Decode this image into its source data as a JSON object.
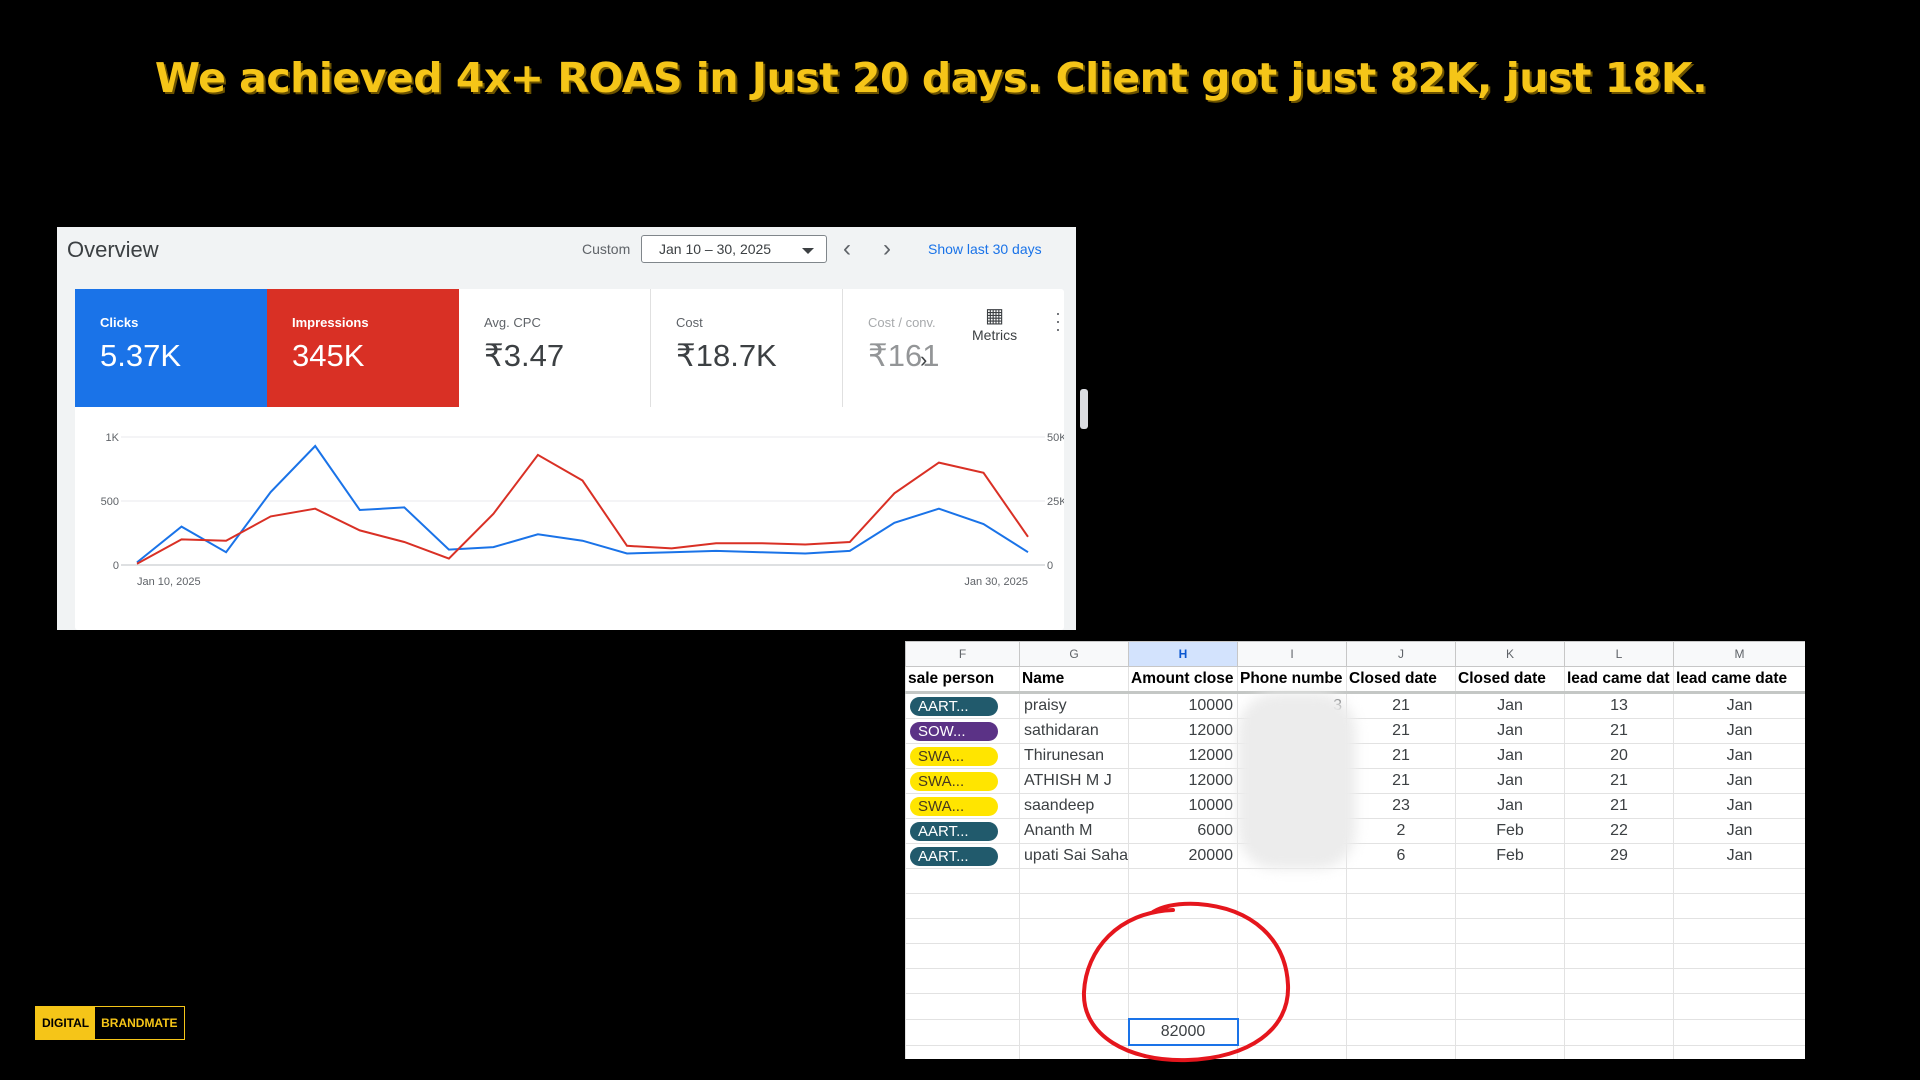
{
  "headline": "We achieved 4x+ ROAS in Just 20 days. Client got just 82K, just 18K.",
  "ads": {
    "title": "Overview",
    "custom_label": "Custom",
    "date_range": "Jan 10 – 30, 2025",
    "show_last": "Show last 30 days",
    "metrics_label": "Metrics",
    "tiles": [
      {
        "label": "Clicks",
        "value": "5.37K"
      },
      {
        "label": "Impressions",
        "value": "345K"
      },
      {
        "label": "Avg. CPC",
        "value": "₹3.47"
      },
      {
        "label": "Cost",
        "value": "₹18.7K"
      },
      {
        "label": "Cost / conv.",
        "value": "₹161"
      }
    ]
  },
  "chart_data": {
    "type": "line",
    "x_start_label": "Jan 10, 2025",
    "x_end_label": "Jan 30, 2025",
    "left_axis": {
      "ticks": [
        "0",
        "500",
        "1K"
      ],
      "ylim": [
        0,
        1000
      ]
    },
    "right_axis": {
      "ticks": [
        "0",
        "25K",
        "50K"
      ],
      "ylim": [
        0,
        50000
      ]
    },
    "series": [
      {
        "name": "Clicks",
        "axis": "left",
        "color": "#1a73e8",
        "values": [
          20,
          300,
          100,
          570,
          930,
          430,
          450,
          120,
          140,
          240,
          190,
          90,
          100,
          110,
          100,
          90,
          110,
          330,
          440,
          320,
          100
        ]
      },
      {
        "name": "Impressions",
        "axis": "right",
        "color": "#d93025",
        "values": [
          500,
          10000,
          9500,
          19000,
          22000,
          13500,
          9000,
          2500,
          20000,
          43000,
          33000,
          7500,
          6500,
          8500,
          8500,
          8000,
          9000,
          28000,
          40000,
          36000,
          11000
        ]
      }
    ]
  },
  "sheet": {
    "col_letters": [
      "F",
      "G",
      "H",
      "I",
      "J",
      "K",
      "L",
      "M"
    ],
    "headers": [
      "sale person",
      "Name",
      "Amount close",
      "Phone numbe",
      "Closed date",
      "Closed date",
      "lead came dat",
      "lead came date"
    ],
    "rows": [
      {
        "person": "AART...",
        "name": "praisy",
        "amount": "10000",
        "phone": "3",
        "closed_day": "21",
        "closed_month": "Jan",
        "lead_day": "13",
        "lead_month": "Jan"
      },
      {
        "person": "SOW...",
        "name": "sathidaran",
        "amount": "12000",
        "phone": "5",
        "closed_day": "21",
        "closed_month": "Jan",
        "lead_day": "21",
        "lead_month": "Jan"
      },
      {
        "person": "SWA...",
        "name": "Thirunesan",
        "amount": "12000",
        "phone": "3",
        "closed_day": "21",
        "closed_month": "Jan",
        "lead_day": "20",
        "lead_month": "Jan"
      },
      {
        "person": "SWA...",
        "name": "ATHISH M J",
        "amount": "12000",
        "phone": "",
        "closed_day": "21",
        "closed_month": "Jan",
        "lead_day": "21",
        "lead_month": "Jan"
      },
      {
        "person": "SWA...",
        "name": "saandeep",
        "amount": "10000",
        "phone": "",
        "closed_day": "23",
        "closed_month": "Jan",
        "lead_day": "21",
        "lead_month": "Jan"
      },
      {
        "person": "AART...",
        "name": "Ananth M",
        "amount": "6000",
        "phone": "",
        "closed_day": "2",
        "closed_month": "Feb",
        "lead_day": "22",
        "lead_month": "Jan"
      },
      {
        "person": "AART...",
        "name": "upati Sai Saha",
        "amount": "20000",
        "phone": "",
        "closed_day": "6",
        "closed_month": "Feb",
        "lead_day": "29",
        "lead_month": "Jan"
      }
    ],
    "total": "82000"
  },
  "brand": {
    "part1": "DIGITAL",
    "part2": "BRANDMATE"
  }
}
